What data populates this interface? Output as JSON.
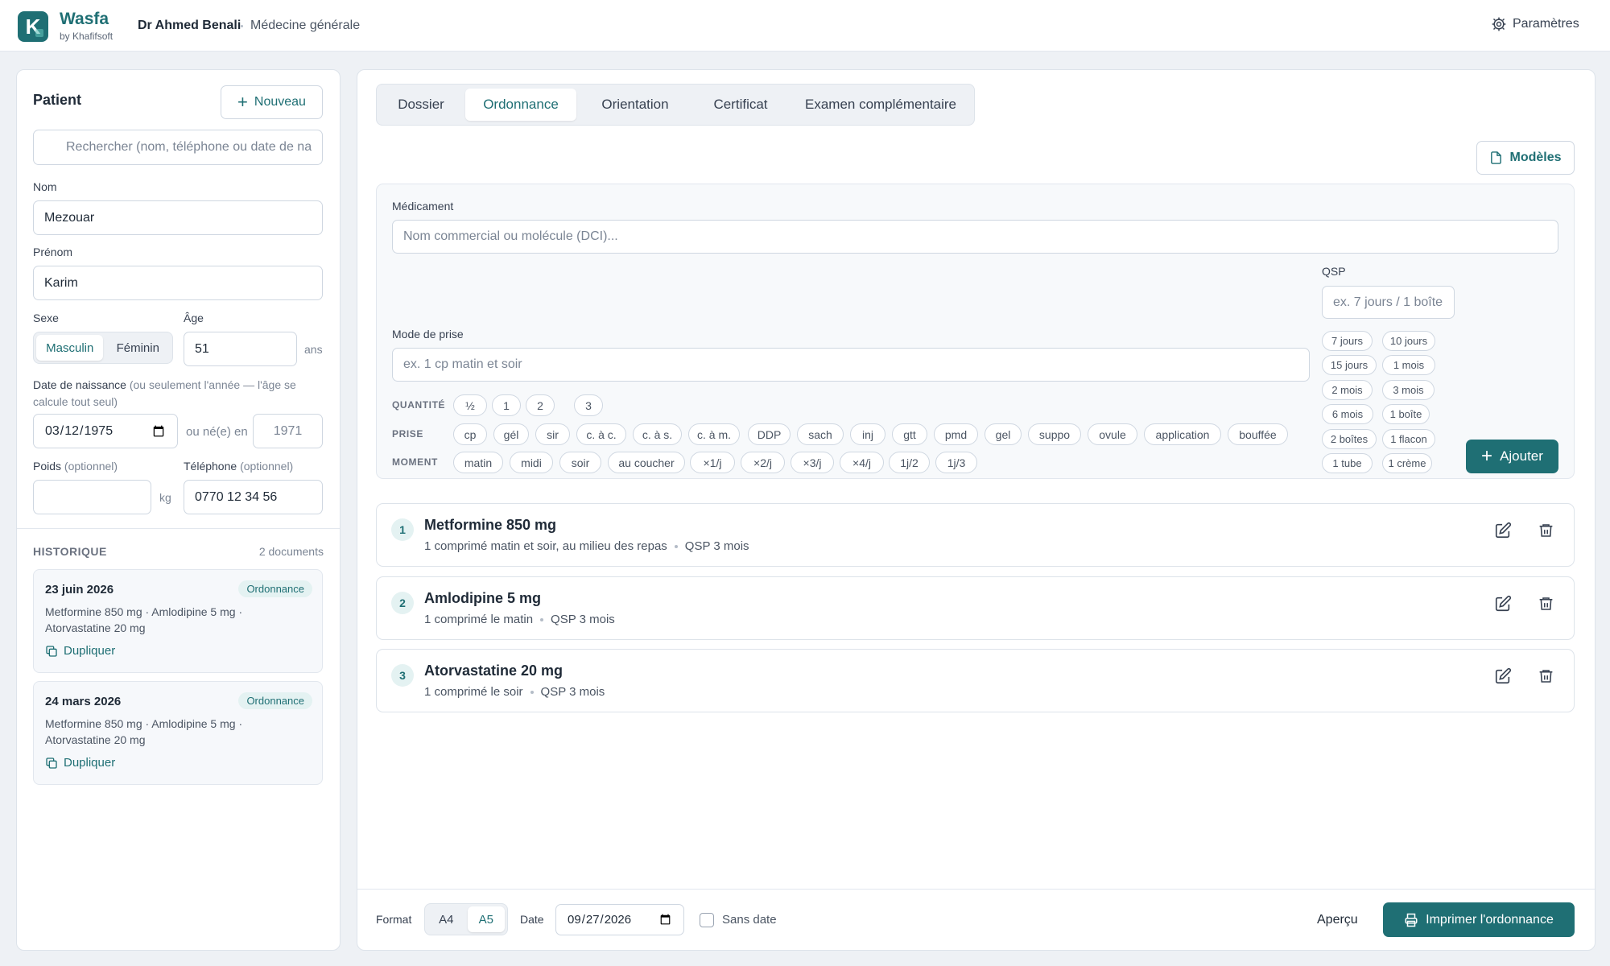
{
  "header": {
    "brand": "Wasfa",
    "brand_sub": "by Khafifsoft",
    "doctor": "Dr Ahmed Benali",
    "specialty": "Médecine générale",
    "settings_label": "Paramètres"
  },
  "patient": {
    "title": "Patient",
    "new_label": "Nouveau",
    "search_placeholder": "Rechercher (nom, téléphone ou date de naissance)",
    "nom_label": "Nom",
    "nom_value": "Mezouar",
    "prenom_label": "Prénom",
    "prenom_value": "Karim",
    "sexe_label": "Sexe",
    "sexe_options": [
      "Masculin",
      "Féminin"
    ],
    "sexe_selected": "Masculin",
    "age_label": "Âge",
    "age_value": "51",
    "age_unit": "ans",
    "dob_label": "Date de naissance",
    "dob_hint": "(ou seulement l'année — l'âge se calcule tout seul)",
    "dob_value": "1975-03-12",
    "ou_ne_label": "ou né(e) en",
    "year_placeholder": "1971",
    "poids_label": "Poids",
    "poids_hint": "(optionnel)",
    "poids_unit": "kg",
    "tel_label": "Téléphone",
    "tel_hint": "(optionnel)",
    "tel_value": "0770 12 34 56"
  },
  "history": {
    "title": "HISTORIQUE",
    "count": "2 documents",
    "items": [
      {
        "date": "23 juin 2026",
        "type": "Ordonnance",
        "meds": "Metformine 850 mg · Amlodipine 5 mg · Atorvastatine 20 mg",
        "action": "Dupliquer"
      },
      {
        "date": "24 mars 2026",
        "type": "Ordonnance",
        "meds": "Metformine 850 mg · Amlodipine 5 mg · Atorvastatine 20 mg",
        "action": "Dupliquer"
      }
    ]
  },
  "tabs": [
    "Dossier",
    "Ordonnance",
    "Orientation",
    "Certificat",
    "Examen complémentaire"
  ],
  "active_tab": "Ordonnance",
  "modeles_label": "Modèles",
  "form": {
    "medicament_label": "Médicament",
    "medicament_placeholder": "Nom commercial ou molécule (DCI)...",
    "mode_label": "Mode de prise",
    "mode_placeholder": "ex. 1 cp matin et soir",
    "qsp_label": "QSP",
    "qsp_placeholder": "ex. 7 jours / 1 boîte",
    "quantite_label": "QUANTITÉ",
    "quantite_chips": [
      "½",
      "1",
      "2",
      "3"
    ],
    "prise_label": "PRISE",
    "prise_chips": [
      "cp",
      "gél",
      "sir",
      "c. à c.",
      "c. à s.",
      "c. à m.",
      "DDP",
      "sach",
      "inj",
      "gtt",
      "pmd",
      "gel",
      "suppo",
      "ovule",
      "application",
      "bouffée"
    ],
    "moment_label": "MOMENT",
    "moment_chips": [
      "matin",
      "midi",
      "soir",
      "au coucher",
      "×1/j",
      "×2/j",
      "×3/j",
      "×4/j",
      "1j/2",
      "1j/3"
    ],
    "qsp_chips": [
      "7 jours",
      "10 jours",
      "15 jours",
      "1 mois",
      "2 mois",
      "3 mois",
      "6 mois",
      "1 boîte",
      "2 boîtes",
      "1 flacon",
      "1 tube",
      "1 crème"
    ],
    "add_label": "Ajouter"
  },
  "prescriptions": [
    {
      "num": "1",
      "name": "Metformine 850 mg",
      "posology": "1 comprimé matin et soir, au milieu des repas",
      "qsp": "QSP 3 mois"
    },
    {
      "num": "2",
      "name": "Amlodipine 5 mg",
      "posology": "1 comprimé le matin",
      "qsp": "QSP 3 mois"
    },
    {
      "num": "3",
      "name": "Atorvastatine 20 mg",
      "posology": "1 comprimé le soir",
      "qsp": "QSP 3 mois"
    }
  ],
  "footer": {
    "format_label": "Format",
    "formats": [
      "A4",
      "A5"
    ],
    "format_selected": "A5",
    "date_label": "Date",
    "date_value": "2026-09-27",
    "sans_date_label": "Sans date",
    "apercu_label": "Aperçu",
    "print_label": "Imprimer l'ordonnance"
  },
  "colors": {
    "accent": "#1f6f74",
    "background": "#eef1f5",
    "badge_bg": "#e4f2f2"
  }
}
